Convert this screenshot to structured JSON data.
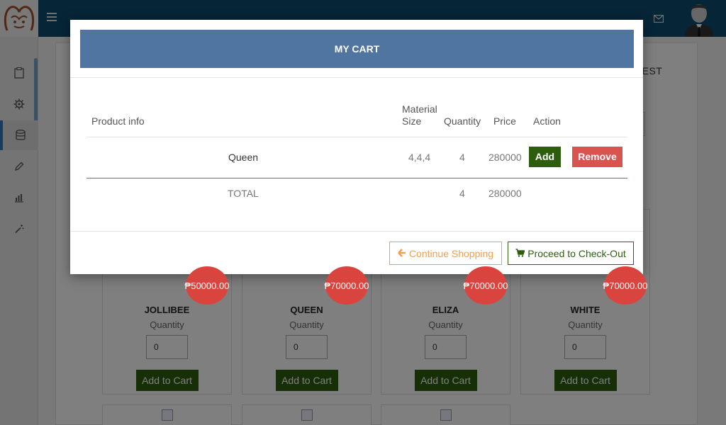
{
  "header": {
    "menu_icon": "hamburger-icon",
    "mail_icon": "envelope-icon",
    "avatar_icon": "user-avatar-icon",
    "logo_icon": "brand-logo-icon"
  },
  "sidebar": {
    "items": [
      {
        "icon": "clipboard-icon"
      },
      {
        "icon": "gear-icon"
      },
      {
        "icon": "database-icon",
        "active": true
      },
      {
        "icon": "pencil-icon"
      },
      {
        "icon": "bar-chart-icon"
      },
      {
        "icon": "magic-wand-icon"
      }
    ]
  },
  "background": {
    "request_label": "UEST",
    "products": [
      {
        "name": "JOLLIBEE",
        "price": "₱50000.00",
        "qty_label": "Quantity",
        "qty": "0",
        "button": "Add to Cart"
      },
      {
        "name": "QUEEN",
        "price": "₱70000.00",
        "qty_label": "Quantity",
        "qty": "0",
        "button": "Add to Cart"
      },
      {
        "name": "ELIZA",
        "price": "₱70000.00",
        "qty_label": "Quantity",
        "qty": "0",
        "button": "Add to Cart"
      },
      {
        "name": "WHITE",
        "price": "₱70000.00",
        "qty_label": "Quantity",
        "qty": "0",
        "button": "Add to Cart"
      }
    ]
  },
  "modal": {
    "title": "MY CART",
    "columns": {
      "product_info": "Product info",
      "material_size_line1": "Material",
      "material_size_line2": "Size",
      "quantity": "Quantity",
      "price": "Price",
      "action": "Action"
    },
    "rows": [
      {
        "product": "Queen",
        "material_size": "4,4,4",
        "quantity": "4",
        "price": "280000",
        "add_label": "Add",
        "remove_label": "Remove"
      }
    ],
    "total": {
      "label": "TOTAL",
      "quantity": "4",
      "price": "280000"
    },
    "footer": {
      "continue_label": "Continue Shopping",
      "continue_icon": "arrow-left-icon",
      "checkout_label": "Proceed to Check-Out",
      "checkout_icon": "shopping-cart-icon"
    }
  },
  "colors": {
    "topbar": "#0d4a6e",
    "modal_header": "#4f75a0",
    "add_green": "#2c5e0e",
    "remove_red": "#d9534f",
    "continue_orange": "#f0a050",
    "price_badge": "#d9453e"
  }
}
